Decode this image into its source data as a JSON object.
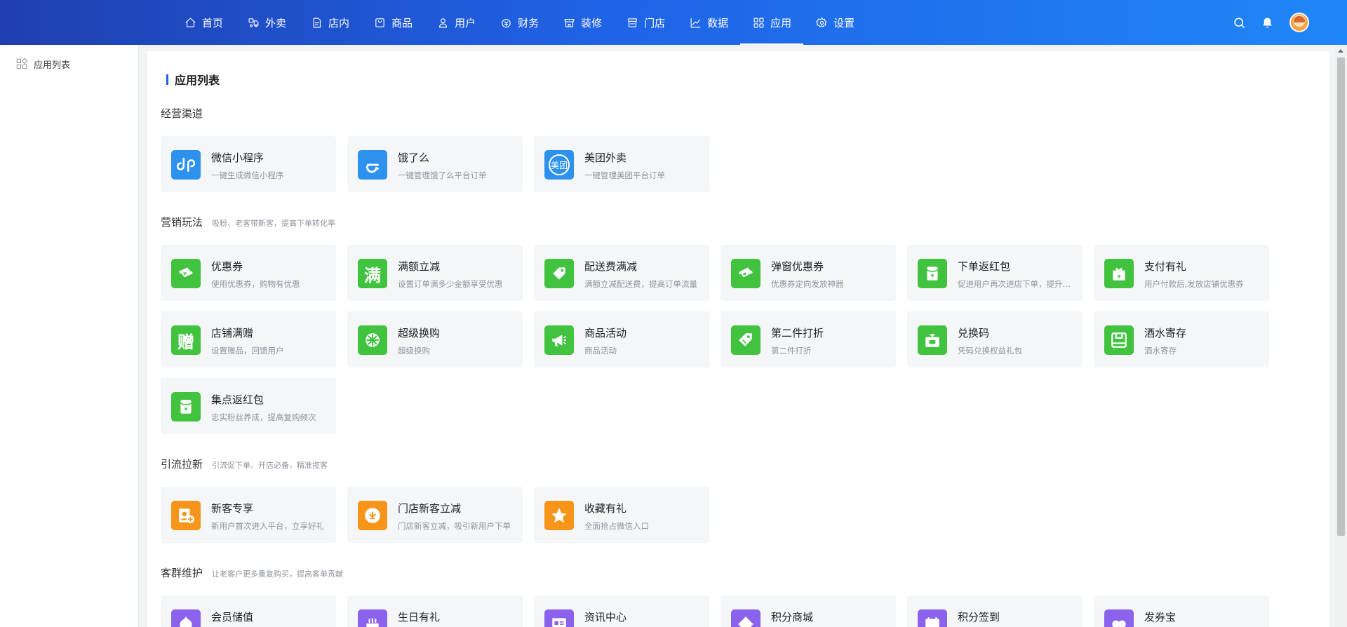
{
  "nav": {
    "items": [
      {
        "label": "首页",
        "icon": "home-icon"
      },
      {
        "label": "外卖",
        "icon": "delivery-icon"
      },
      {
        "label": "店内",
        "icon": "store-order-icon"
      },
      {
        "label": "商品",
        "icon": "bag-icon"
      },
      {
        "label": "用户",
        "icon": "user-icon"
      },
      {
        "label": "财务",
        "icon": "money-bag-icon"
      },
      {
        "label": "装修",
        "icon": "shop-decor-icon"
      },
      {
        "label": "门店",
        "icon": "storefront-icon"
      },
      {
        "label": "数据",
        "icon": "chart-icon"
      },
      {
        "label": "应用",
        "icon": "apps-grid-icon"
      },
      {
        "label": "设置",
        "icon": "gear-icon"
      }
    ],
    "active": "应用"
  },
  "sidebar": {
    "items": [
      {
        "label": "应用列表",
        "icon": "apps-grid-icon"
      }
    ]
  },
  "page_title": "应用列表",
  "sections": [
    {
      "title": "经营渠道",
      "desc": "",
      "cards": [
        {
          "title": "微信小程序",
          "desc": "一键生成微信小程序",
          "color": "#2d92ee",
          "icon": "mini-program-icon"
        },
        {
          "title": "饿了么",
          "desc": "一键管理饿了么平台订单",
          "color": "#2d92ee",
          "icon": "eleme-icon"
        },
        {
          "title": "美团外卖",
          "desc": "一键管理美团平台订单",
          "color": "#2d92ee",
          "icon": "meituan-icon",
          "glyph": "美团"
        }
      ]
    },
    {
      "title": "营销玩法",
      "desc": "吸粉、老客带新客，提高下单转化率",
      "cards": [
        {
          "title": "优惠券",
          "desc": "使用优惠券，购物有优惠",
          "color": "#42c340",
          "icon": "coupon-icon"
        },
        {
          "title": "满额立减",
          "desc": "设置订单满多少金额享受优惠",
          "color": "#42c340",
          "icon": "full-reduction-icon",
          "glyph": "满"
        },
        {
          "title": "配送费满减",
          "desc": "满额立减配送费，提高订单流量",
          "color": "#42c340",
          "icon": "delivery-discount-icon"
        },
        {
          "title": "弹窗优惠券",
          "desc": "优惠券定向发放神器",
          "color": "#42c340",
          "icon": "popup-coupon-icon"
        },
        {
          "title": "下单返红包",
          "desc": "促进用户再次进店下单，提升复购",
          "color": "#42c340",
          "icon": "red-packet-icon"
        },
        {
          "title": "支付有礼",
          "desc": "用户付款后,发放店铺优惠券",
          "color": "#42c340",
          "icon": "pay-gift-icon"
        },
        {
          "title": "店铺满赠",
          "desc": "设置赠品，回馈用户",
          "color": "#42c340",
          "icon": "gift-icon",
          "glyph": "赠"
        },
        {
          "title": "超级换购",
          "desc": "超级换购",
          "color": "#42c340",
          "icon": "exchange-purchase-icon"
        },
        {
          "title": "商品活动",
          "desc": "商品活动",
          "color": "#42c340",
          "icon": "megaphone-icon"
        },
        {
          "title": "第二件打折",
          "desc": "第二件打折",
          "color": "#42c340",
          "icon": "discount-tag-icon"
        },
        {
          "title": "兑换码",
          "desc": "凭码兑换权益礼包",
          "color": "#42c340",
          "icon": "redeem-code-icon"
        },
        {
          "title": "酒水寄存",
          "desc": "酒水寄存",
          "color": "#42c340",
          "icon": "storage-icon"
        },
        {
          "title": "集点返红包",
          "desc": "忠实粉丝养成，提高复购频次",
          "color": "#42c340",
          "icon": "points-red-packet-icon"
        }
      ]
    },
    {
      "title": "引流拉新",
      "desc": "引流促下单、开店必备，精准揽客",
      "cards": [
        {
          "title": "新客专享",
          "desc": "新用户首次进入平台，立享好礼",
          "color": "#f7951a",
          "icon": "new-customer-icon"
        },
        {
          "title": "门店新客立减",
          "desc": "门店新客立减，吸引新用户下单",
          "color": "#f7951a",
          "icon": "new-customer-discount-icon"
        },
        {
          "title": "收藏有礼",
          "desc": "全面抢占微信入口",
          "color": "#f7951a",
          "icon": "star-icon"
        }
      ]
    },
    {
      "title": "客群维护",
      "desc": "让老客户更多重复购买，提高客单贡献",
      "cards": [
        {
          "title": "会员储值",
          "desc": "",
          "color": "#8a62ec",
          "icon": "member-recharge-icon"
        },
        {
          "title": "生日有礼",
          "desc": "",
          "color": "#8a62ec",
          "icon": "birthday-cake-icon"
        },
        {
          "title": "资讯中心",
          "desc": "",
          "color": "#8a62ec",
          "icon": "news-icon"
        },
        {
          "title": "积分商城",
          "desc": "",
          "color": "#8a62ec",
          "icon": "points-mall-icon"
        },
        {
          "title": "积分签到",
          "desc": "",
          "color": "#8a62ec",
          "icon": "calendar-icon"
        },
        {
          "title": "发券宝",
          "desc": "",
          "color": "#8a62ec",
          "icon": "coupon-send-icon"
        }
      ]
    }
  ]
}
